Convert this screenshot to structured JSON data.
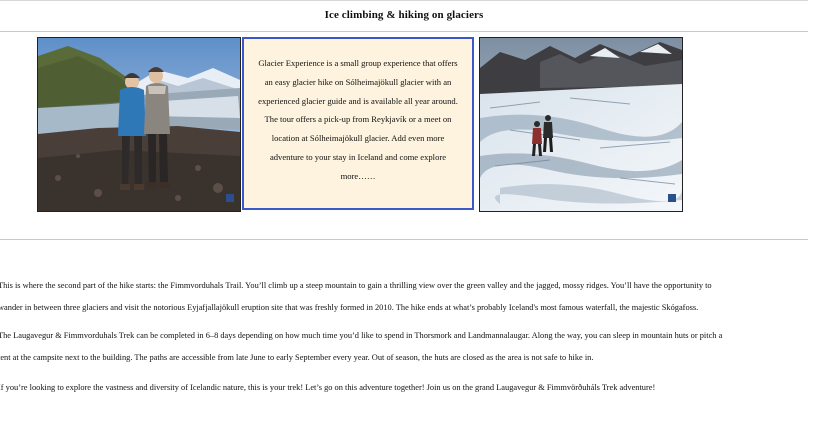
{
  "page": {
    "title": "Ice climbing & hiking on glaciers"
  },
  "info_box": {
    "text": "Glacier Experience is a small group experience that offers an easy glacier hike on Sólheimajökull glacier with an experienced glacier guide and is available all year around. The tour offers a pick-up from Reykjavík or a meet on location at Sólheimajökull glacier. Add even more adventure to your stay in Iceland and come explore more……"
  },
  "paragraphs": [
    {
      "lines": [
        "This is where the second part of the hike starts: the Fimmvorduhals Trail. You’ll climb up a steep mountain to gain a thrilling view over the green valley and the jagged, mossy ridges. You’ll have the opportunity to",
        "wander in between three glaciers and visit the notorious Eyjafjallajökull eruption site that was freshly formed in 2010. The hike ends at what’s probably Iceland's most famous waterfall, the majestic Skógafoss."
      ]
    },
    {
      "lines": [
        "The Laugavegur & Fimmvorduhals Trek can be completed in 6–8 days depending on how much time you’d like to spend in Thorsmork and Landmannalaugar. Along the way, you can sleep in mountain huts or pitch a",
        "tent at the campsite next to the building. The paths are accessible from late June to early September every year. Out of season, the huts are closed as the area is not safe to hike in."
      ]
    },
    {
      "lines": [
        "If you’re looking to explore the vastness and diversity of Icelandic nature, this is your trek! Let’s go on this adventure together! Join us on the grand Laugavegur & Fimmvörðuháls Trek adventure!"
      ]
    }
  ],
  "colors": {
    "info_box_border": "#3a58c7",
    "info_box_background": "#fdf3de"
  }
}
